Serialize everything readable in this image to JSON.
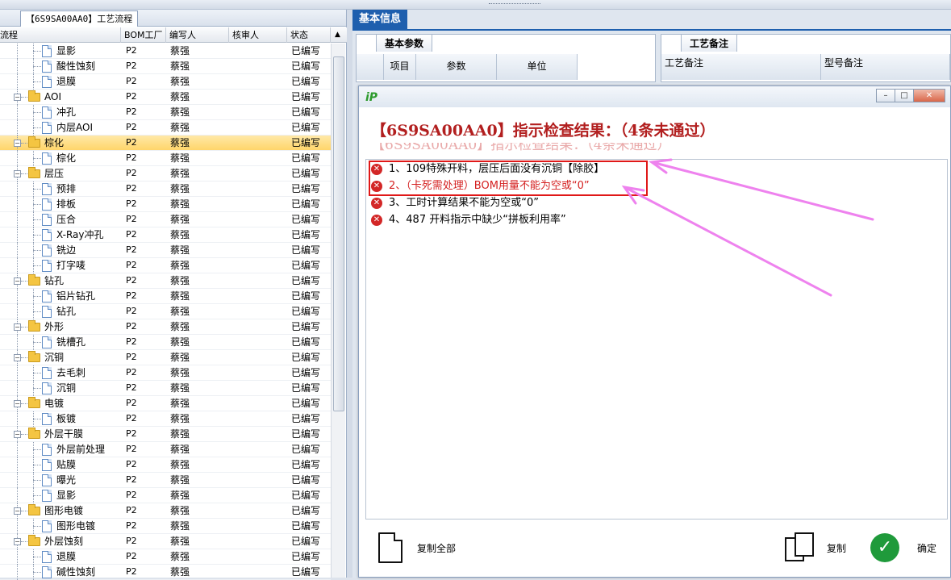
{
  "left_panel": {
    "tab_title": "【6S9SA00AA0】工艺流程",
    "columns": [
      "流程",
      "BOM工厂",
      "编写人",
      "核审人",
      "状态"
    ],
    "rows": [
      {
        "name": "显影",
        "type": "doc",
        "factory": "P2",
        "author": "蔡强",
        "reviewer": "",
        "status": "已编写"
      },
      {
        "name": "酸性蚀刻",
        "type": "doc",
        "factory": "P2",
        "author": "蔡强",
        "reviewer": "",
        "status": "已编写"
      },
      {
        "name": "退膜",
        "type": "doc",
        "factory": "P2",
        "author": "蔡强",
        "reviewer": "",
        "status": "已编写"
      },
      {
        "name": "AOI",
        "type": "folder",
        "factory": "P2",
        "author": "蔡强",
        "reviewer": "",
        "status": "已编写"
      },
      {
        "name": "冲孔",
        "type": "doc",
        "factory": "P2",
        "author": "蔡强",
        "reviewer": "",
        "status": "已编写"
      },
      {
        "name": "内层AOI",
        "type": "doc",
        "factory": "P2",
        "author": "蔡强",
        "reviewer": "",
        "status": "已编写"
      },
      {
        "name": "棕化",
        "type": "folder",
        "factory": "P2",
        "author": "蔡强",
        "reviewer": "",
        "status": "已编写",
        "selected": true
      },
      {
        "name": "棕化",
        "type": "doc",
        "factory": "P2",
        "author": "蔡强",
        "reviewer": "",
        "status": "已编写"
      },
      {
        "name": "层压",
        "type": "folder",
        "factory": "P2",
        "author": "蔡强",
        "reviewer": "",
        "status": "已编写"
      },
      {
        "name": "预排",
        "type": "doc",
        "factory": "P2",
        "author": "蔡强",
        "reviewer": "",
        "status": "已编写"
      },
      {
        "name": "排板",
        "type": "doc",
        "factory": "P2",
        "author": "蔡强",
        "reviewer": "",
        "status": "已编写"
      },
      {
        "name": "压合",
        "type": "doc",
        "factory": "P2",
        "author": "蔡强",
        "reviewer": "",
        "status": "已编写"
      },
      {
        "name": "X-Ray冲孔",
        "type": "doc",
        "factory": "P2",
        "author": "蔡强",
        "reviewer": "",
        "status": "已编写"
      },
      {
        "name": "铣边",
        "type": "doc",
        "factory": "P2",
        "author": "蔡强",
        "reviewer": "",
        "status": "已编写"
      },
      {
        "name": "打字唛",
        "type": "doc",
        "factory": "P2",
        "author": "蔡强",
        "reviewer": "",
        "status": "已编写"
      },
      {
        "name": "钻孔",
        "type": "folder",
        "factory": "P2",
        "author": "蔡强",
        "reviewer": "",
        "status": "已编写"
      },
      {
        "name": "铝片钻孔",
        "type": "doc",
        "factory": "P2",
        "author": "蔡强",
        "reviewer": "",
        "status": "已编写"
      },
      {
        "name": "钻孔",
        "type": "doc",
        "factory": "P2",
        "author": "蔡强",
        "reviewer": "",
        "status": "已编写"
      },
      {
        "name": "外形",
        "type": "folder",
        "factory": "P2",
        "author": "蔡强",
        "reviewer": "",
        "status": "已编写"
      },
      {
        "name": "铣槽孔",
        "type": "doc",
        "factory": "P2",
        "author": "蔡强",
        "reviewer": "",
        "status": "已编写"
      },
      {
        "name": "沉铜",
        "type": "folder",
        "factory": "P2",
        "author": "蔡强",
        "reviewer": "",
        "status": "已编写"
      },
      {
        "name": "去毛刺",
        "type": "doc",
        "factory": "P2",
        "author": "蔡强",
        "reviewer": "",
        "status": "已编写"
      },
      {
        "name": "沉铜",
        "type": "doc",
        "factory": "P2",
        "author": "蔡强",
        "reviewer": "",
        "status": "已编写"
      },
      {
        "name": "电镀",
        "type": "folder",
        "factory": "P2",
        "author": "蔡强",
        "reviewer": "",
        "status": "已编写"
      },
      {
        "name": "板镀",
        "type": "doc",
        "factory": "P2",
        "author": "蔡强",
        "reviewer": "",
        "status": "已编写"
      },
      {
        "name": "外层干膜",
        "type": "folder",
        "factory": "P2",
        "author": "蔡强",
        "reviewer": "",
        "status": "已编写"
      },
      {
        "name": "外层前处理",
        "type": "doc",
        "factory": "P2",
        "author": "蔡强",
        "reviewer": "",
        "status": "已编写"
      },
      {
        "name": "贴膜",
        "type": "doc",
        "factory": "P2",
        "author": "蔡强",
        "reviewer": "",
        "status": "已编写"
      },
      {
        "name": "曝光",
        "type": "doc",
        "factory": "P2",
        "author": "蔡强",
        "reviewer": "",
        "status": "已编写"
      },
      {
        "name": "显影",
        "type": "doc",
        "factory": "P2",
        "author": "蔡强",
        "reviewer": "",
        "status": "已编写"
      },
      {
        "name": "图形电镀",
        "type": "folder",
        "factory": "P2",
        "author": "蔡强",
        "reviewer": "",
        "status": "已编写"
      },
      {
        "name": "图形电镀",
        "type": "doc",
        "factory": "P2",
        "author": "蔡强",
        "reviewer": "",
        "status": "已编写"
      },
      {
        "name": "外层蚀刻",
        "type": "folder",
        "factory": "P2",
        "author": "蔡强",
        "reviewer": "",
        "status": "已编写"
      },
      {
        "name": "退膜",
        "type": "doc",
        "factory": "P2",
        "author": "蔡强",
        "reviewer": "",
        "status": "已编写"
      },
      {
        "name": "碱性蚀刻",
        "type": "doc",
        "factory": "P2",
        "author": "蔡强",
        "reviewer": "",
        "status": "已编写"
      }
    ]
  },
  "right_panel": {
    "tab_label": "基本信息",
    "basic_params": {
      "tab_label": "基本参数",
      "columns": [
        "项目",
        "参数",
        "单位"
      ]
    },
    "process_notes": {
      "tab_label": "工艺备注",
      "columns": [
        "工艺备注",
        "型号备注"
      ]
    }
  },
  "dialog": {
    "logo": "iP",
    "header": "【6S9SA00AA0】指示检查结果：（4条未通过）",
    "ghost_text": "【6S9SA00AA0】指示检查结果：（4条未通过）",
    "items": [
      {
        "text": "1、109特殊开料，层压后面没有沉铜【除胶】",
        "color": "#000000"
      },
      {
        "text": "2、（卡死需处理）BOM用量不能为空或“0”",
        "color": "#d42020"
      },
      {
        "text": "3、工时计算结果不能为空或“0”",
        "color": "#000000"
      },
      {
        "text": "4、487 开料指示中缺少“拼板利用率”",
        "color": "#000000"
      }
    ],
    "footer": {
      "copy_all": "复制全部",
      "copy": "复制",
      "ok": "确定"
    },
    "window_buttons": {
      "min": "–",
      "max": "□",
      "close": "✕"
    }
  },
  "annotation_color": "#ee82ee"
}
